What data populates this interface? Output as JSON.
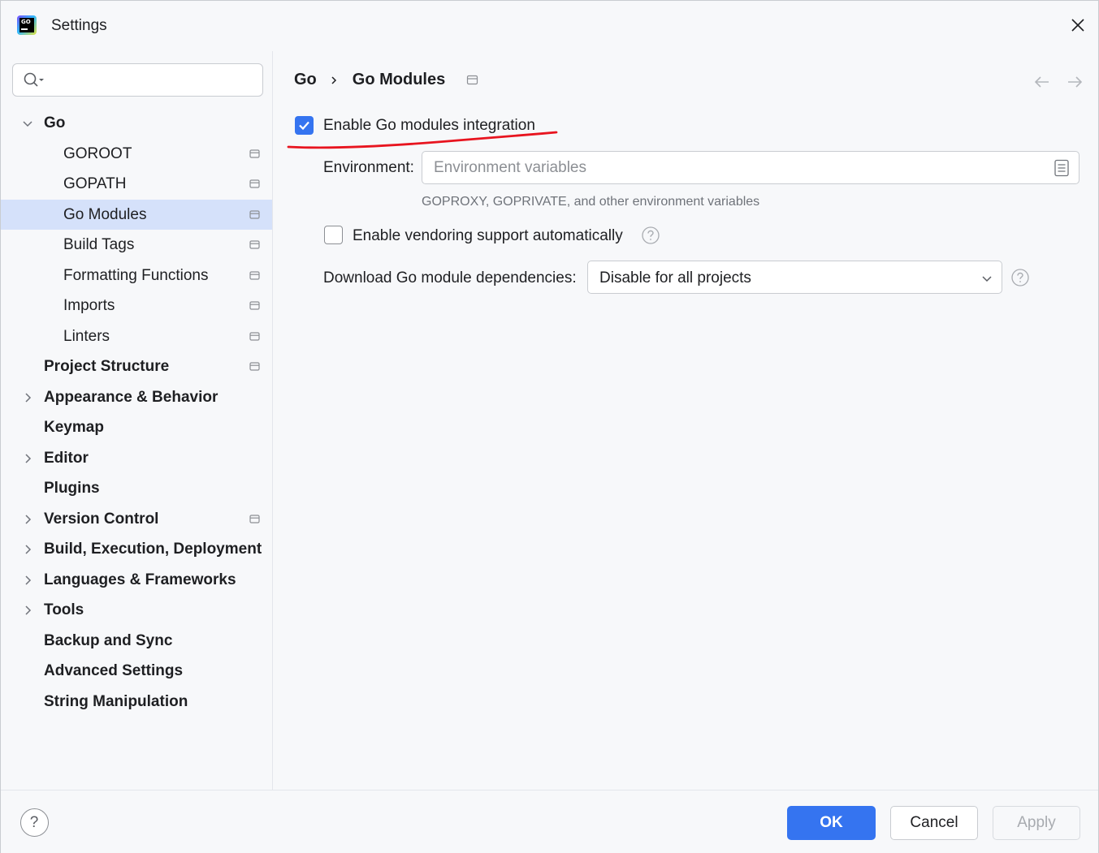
{
  "window": {
    "title": "Settings",
    "app_icon_text": "GO"
  },
  "sidebar": {
    "search": {
      "value": "",
      "placeholder": ""
    },
    "items": [
      {
        "label": "Go",
        "level": 0,
        "expandable": true,
        "expanded": true,
        "pinned": false,
        "selected": false
      },
      {
        "label": "GOROOT",
        "level": 1,
        "expandable": false,
        "pinned": true,
        "selected": false
      },
      {
        "label": "GOPATH",
        "level": 1,
        "expandable": false,
        "pinned": true,
        "selected": false
      },
      {
        "label": "Go Modules",
        "level": 1,
        "expandable": false,
        "pinned": true,
        "selected": true
      },
      {
        "label": "Build Tags",
        "level": 1,
        "expandable": false,
        "pinned": true,
        "selected": false
      },
      {
        "label": "Formatting Functions",
        "level": 1,
        "expandable": false,
        "pinned": true,
        "selected": false
      },
      {
        "label": "Imports",
        "level": 1,
        "expandable": false,
        "pinned": true,
        "selected": false
      },
      {
        "label": "Linters",
        "level": 1,
        "expandable": false,
        "pinned": true,
        "selected": false
      },
      {
        "label": "Project Structure",
        "level": 0,
        "expandable": false,
        "pinned": true,
        "selected": false
      },
      {
        "label": "Appearance & Behavior",
        "level": 0,
        "expandable": true,
        "expanded": false,
        "pinned": false,
        "selected": false
      },
      {
        "label": "Keymap",
        "level": 0,
        "expandable": false,
        "pinned": false,
        "selected": false
      },
      {
        "label": "Editor",
        "level": 0,
        "expandable": true,
        "expanded": false,
        "pinned": false,
        "selected": false
      },
      {
        "label": "Plugins",
        "level": 0,
        "expandable": false,
        "pinned": false,
        "selected": false
      },
      {
        "label": "Version Control",
        "level": 0,
        "expandable": true,
        "expanded": false,
        "pinned": true,
        "selected": false
      },
      {
        "label": "Build, Execution, Deployment",
        "level": 0,
        "expandable": true,
        "expanded": false,
        "pinned": false,
        "selected": false
      },
      {
        "label": "Languages & Frameworks",
        "level": 0,
        "expandable": true,
        "expanded": false,
        "pinned": false,
        "selected": false
      },
      {
        "label": "Tools",
        "level": 0,
        "expandable": true,
        "expanded": false,
        "pinned": false,
        "selected": false
      },
      {
        "label": "Backup and Sync",
        "level": 0,
        "expandable": false,
        "pinned": false,
        "selected": false
      },
      {
        "label": "Advanced Settings",
        "level": 0,
        "expandable": false,
        "pinned": false,
        "selected": false
      },
      {
        "label": "String Manipulation",
        "level": 0,
        "expandable": false,
        "pinned": false,
        "selected": false
      }
    ]
  },
  "content": {
    "breadcrumb": [
      "Go",
      "Go Modules"
    ],
    "enable_modules": {
      "label": "Enable Go modules integration",
      "checked": true
    },
    "environment": {
      "label": "Environment:",
      "value": "",
      "placeholder": "Environment variables",
      "hint": "GOPROXY, GOPRIVATE, and other environment variables"
    },
    "vendoring": {
      "label": "Enable vendoring support automatically",
      "checked": false
    },
    "download": {
      "label": "Download Go module dependencies:",
      "selected": "Disable for all projects"
    }
  },
  "footer": {
    "help_label": "?",
    "ok_label": "OK",
    "cancel_label": "Cancel",
    "apply_label": "Apply"
  },
  "colors": {
    "accent": "#3574f0",
    "selection": "#d5e1fa",
    "annotation": "#e8141f",
    "background": "#f7f8fa"
  },
  "icons": {
    "window": "goland-app-icon",
    "close": "close-icon",
    "search": "search-icon",
    "expand": "chevron-right-icon",
    "collapse": "chevron-down-icon",
    "pin": "pin-icon",
    "back": "arrow-left-icon",
    "forward": "arrow-right-icon",
    "env_editor": "document-icon",
    "help": "help-circle-icon",
    "dropdown": "chevron-down-icon"
  }
}
